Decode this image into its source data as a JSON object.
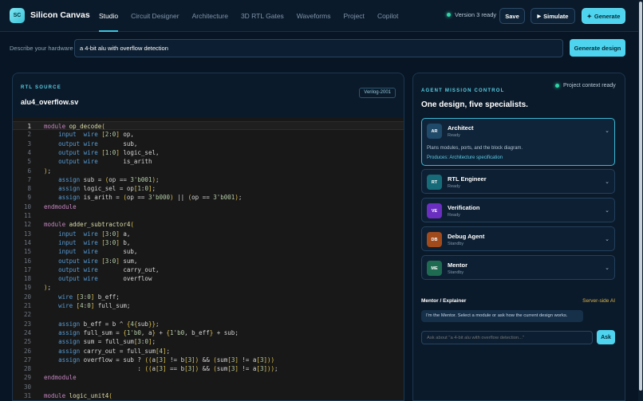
{
  "app": {
    "logo_text": "SC",
    "brand": "Silicon Canvas"
  },
  "nav": {
    "tabs": [
      {
        "label": "Studio",
        "active": true
      },
      {
        "label": "Circuit Designer",
        "active": false
      },
      {
        "label": "Architecture",
        "active": false
      },
      {
        "label": "3D RTL Gates",
        "active": false
      },
      {
        "label": "Waveforms",
        "active": false
      },
      {
        "label": "Project",
        "active": false
      },
      {
        "label": "Copilot",
        "active": false
      }
    ]
  },
  "toolbar": {
    "version_status": "Version 3 ready",
    "save_label": "Save",
    "simulate_label": "Simulate",
    "generate_label": "Generate",
    "simulate_icon": "play-icon",
    "generate_icon": "sparkle-icon"
  },
  "describe": {
    "label": "Describe your hardware",
    "value": "a 4-bit alu with overflow detection",
    "button_label": "Generate design"
  },
  "rtl": {
    "kicker": "RTL SOURCE",
    "file_name": "alu4_overflow.sv",
    "language": "Verilog-2001",
    "current_line": 1,
    "lines": [
      {
        "n": "1",
        "t": "module op_decode("
      },
      {
        "n": "2",
        "t": "    input  wire [2:0] op,"
      },
      {
        "n": "3",
        "t": "    output wire       sub,"
      },
      {
        "n": "4",
        "t": "    output wire [1:0] logic_sel,"
      },
      {
        "n": "5",
        "t": "    output wire       is_arith"
      },
      {
        "n": "6",
        "t": ");"
      },
      {
        "n": "7",
        "t": "    assign sub = (op == 3'b001);"
      },
      {
        "n": "8",
        "t": "    assign logic_sel = op[1:0];"
      },
      {
        "n": "9",
        "t": "    assign is_arith = (op == 3'b000) || (op == 3'b001);"
      },
      {
        "n": "10",
        "t": "endmodule"
      },
      {
        "n": "11",
        "t": ""
      },
      {
        "n": "12",
        "t": "module adder_subtractor4("
      },
      {
        "n": "13",
        "t": "    input  wire [3:0] a,"
      },
      {
        "n": "14",
        "t": "    input  wire [3:0] b,"
      },
      {
        "n": "15",
        "t": "    input  wire       sub,"
      },
      {
        "n": "16",
        "t": "    output wire [3:0] sum,"
      },
      {
        "n": "17",
        "t": "    output wire       carry_out,"
      },
      {
        "n": "18",
        "t": "    output wire       overflow"
      },
      {
        "n": "19",
        "t": ");"
      },
      {
        "n": "20",
        "t": "    wire [3:0] b_eff;"
      },
      {
        "n": "21",
        "t": "    wire [4:0] full_sum;"
      },
      {
        "n": "22",
        "t": ""
      },
      {
        "n": "23",
        "t": "    assign b_eff = b ^ {4{sub}};"
      },
      {
        "n": "24",
        "t": "    assign full_sum = {1'b0, a} + {1'b0, b_eff} + sub;"
      },
      {
        "n": "25",
        "t": "    assign sum = full_sum[3:0];"
      },
      {
        "n": "26",
        "t": "    assign carry_out = full_sum[4];"
      },
      {
        "n": "27",
        "t": "    assign overflow = sub ? ((a[3] != b[3]) && (sum[3] != a[3]))"
      },
      {
        "n": "28",
        "t": "                          : ((a[3] == b[3]) && (sum[3] != a[3]));"
      },
      {
        "n": "29",
        "t": "endmodule"
      },
      {
        "n": "30",
        "t": ""
      },
      {
        "n": "31",
        "t": "module logic_unit4("
      }
    ]
  },
  "mission": {
    "kicker": "AGENT MISSION CONTROL",
    "context_status": "Project context ready",
    "title": "One design, five specialists.",
    "agents": [
      {
        "initials": "AR",
        "name": "Architect",
        "status": "Ready",
        "color": "#1f4a6a",
        "expanded": true,
        "description": "Plans modules, ports, and the block diagram.",
        "produces": "Produces: Architecture specification"
      },
      {
        "initials": "RT",
        "name": "RTL Engineer",
        "status": "Ready",
        "color": "#176b78",
        "expanded": false
      },
      {
        "initials": "VE",
        "name": "Verification",
        "status": "Ready",
        "color": "#6a2fc0",
        "expanded": false
      },
      {
        "initials": "DB",
        "name": "Debug Agent",
        "status": "Standby",
        "color": "#a14a1c",
        "expanded": false
      },
      {
        "initials": "ME",
        "name": "Mentor",
        "status": "Standby",
        "color": "#1e6b52",
        "expanded": false
      }
    ],
    "mentor": {
      "title": "Mentor / Explainer",
      "server_badge": "Server-side AI",
      "message": "I'm the Mentor. Select a module or ask how the current design works.",
      "input_placeholder": "Ask about \"a 4-bit alu with overflow detection...\"",
      "ask_label": "Ask"
    }
  },
  "colors": {
    "accent": "#4ed4ee",
    "ready_dot": "#2fd4a6",
    "background": "#071524"
  }
}
